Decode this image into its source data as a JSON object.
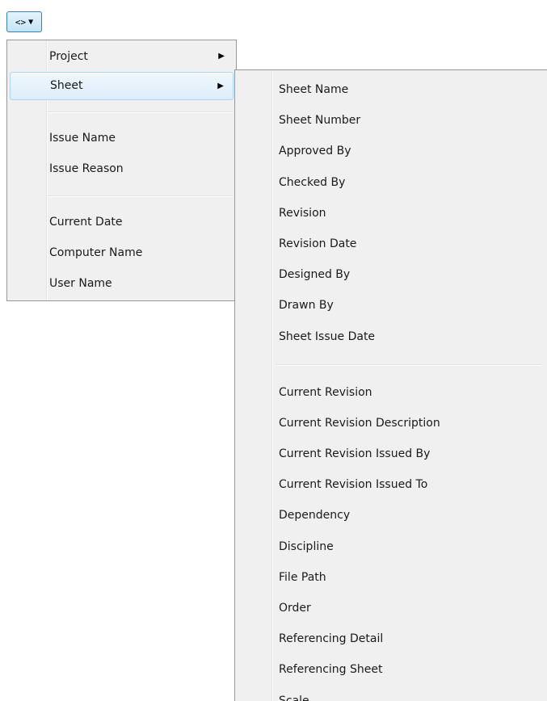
{
  "toolbar": {
    "button_label": "<>",
    "caret": "▼"
  },
  "main_menu": {
    "arrow": "▶",
    "items": [
      {
        "label": "Project"
      },
      {
        "label": "Sheet"
      },
      {
        "label": "Issue Name"
      },
      {
        "label": "Issue Reason"
      },
      {
        "label": "Current Date"
      },
      {
        "label": "Computer Name"
      },
      {
        "label": "User Name"
      }
    ]
  },
  "sheet_submenu": {
    "items": [
      {
        "label": "Sheet Name"
      },
      {
        "label": "Sheet Number"
      },
      {
        "label": "Approved By"
      },
      {
        "label": "Checked By"
      },
      {
        "label": "Revision"
      },
      {
        "label": "Revision Date"
      },
      {
        "label": "Designed By"
      },
      {
        "label": "Drawn By"
      },
      {
        "label": "Sheet Issue Date"
      },
      {
        "label": "Current Revision"
      },
      {
        "label": "Current Revision Description"
      },
      {
        "label": "Current Revision Issued By"
      },
      {
        "label": "Current Revision Issued To"
      },
      {
        "label": "Dependency"
      },
      {
        "label": "Discipline"
      },
      {
        "label": "File Path"
      },
      {
        "label": "Order"
      },
      {
        "label": "Referencing Detail"
      },
      {
        "label": "Referencing Sheet"
      },
      {
        "label": "Scale"
      }
    ]
  },
  "colors": {
    "menu_background": "#f0f0f0",
    "menu_border": "#979797",
    "highlight_border": "#a8d8f6",
    "button_border": "#3c7fb1"
  }
}
